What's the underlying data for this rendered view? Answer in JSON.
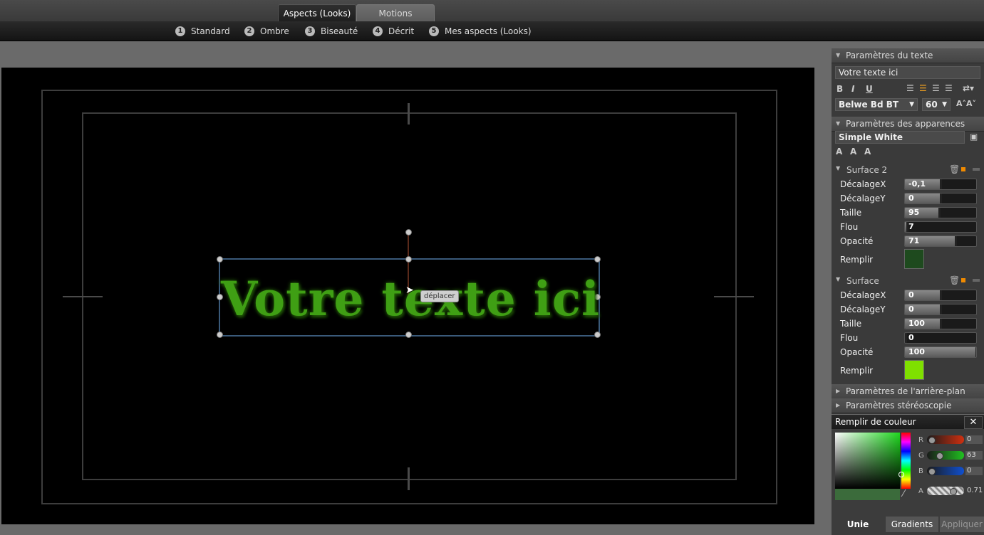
{
  "top_tabs": {
    "looks": "Aspects (Looks)",
    "motions": "Motions"
  },
  "presets": [
    {
      "num": "1",
      "label": "Standard"
    },
    {
      "num": "2",
      "label": "Ombre"
    },
    {
      "num": "3",
      "label": "Biseauté"
    },
    {
      "num": "4",
      "label": "Décrit"
    },
    {
      "num": "5",
      "label": "Mes aspects (Looks)"
    }
  ],
  "canvas": {
    "text": "Votre texte ici",
    "tooltip": "déplacer",
    "text_color": "#3f9f14"
  },
  "panel": {
    "text_params": {
      "title": "Paramètres du texte",
      "text_value": "Votre texte ici",
      "bold": "B",
      "italic": "I",
      "underline": "U",
      "font": "Belwe Bd BT",
      "size": "60"
    },
    "appearance": {
      "title": "Paramètres des apparences",
      "preset": "Simple White",
      "surface2": {
        "title": "Surface 2",
        "rows": [
          {
            "label": "DécalageX",
            "value": "-0,1",
            "level": 0.5
          },
          {
            "label": "DécalageY",
            "value": "0",
            "level": 0.5
          },
          {
            "label": "Taille",
            "value": "95",
            "level": 0.48
          },
          {
            "label": "Flou",
            "value": "7",
            "level": 0.03
          },
          {
            "label": "Opacité",
            "value": "71",
            "level": 0.71
          }
        ],
        "fill_label": "Remplir",
        "fill_color": "#1e4a1e"
      },
      "surface": {
        "title": "Surface",
        "rows": [
          {
            "label": "DécalageX",
            "value": "0",
            "level": 0.5
          },
          {
            "label": "DécalageY",
            "value": "0",
            "level": 0.5
          },
          {
            "label": "Taille",
            "value": "100",
            "level": 0.5
          },
          {
            "label": "Flou",
            "value": "0",
            "level": 0.0
          },
          {
            "label": "Opacité",
            "value": "100",
            "level": 1.0
          }
        ],
        "fill_label": "Remplir",
        "fill_color": "#7fe000"
      }
    },
    "background": "Paramètres de l'arrière-plan",
    "stereo": "Paramètres stéréoscopie"
  },
  "color_fill": {
    "title": "Remplir de couleur",
    "close": "✕",
    "channels": [
      {
        "label": "R",
        "value": "0"
      },
      {
        "label": "G",
        "value": "63"
      },
      {
        "label": "B",
        "value": "0"
      },
      {
        "label": "A",
        "value": "0.71"
      }
    ],
    "tabs": {
      "solid": "Unie",
      "gradients": "Gradients",
      "apply": "Appliquer"
    }
  }
}
